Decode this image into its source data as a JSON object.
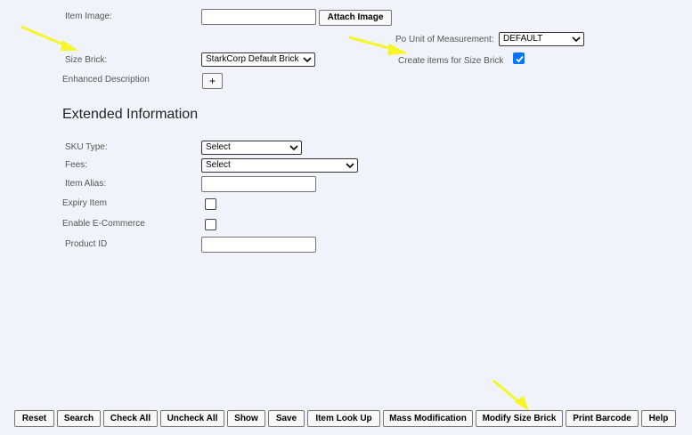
{
  "form": {
    "item_image_label": "Item Image:",
    "attach_image_button": "Attach Image",
    "po_unit_label": "Po Unit of Measurement:",
    "po_unit_value": "DEFAULT",
    "size_brick_label": "Size Brick:",
    "size_brick_value": "StarkCorp Default Brick",
    "create_items_label": "Create items for Size Brick",
    "create_items_checked": true,
    "enhanced_description_label": "Enhanced Description",
    "enhanced_description_button": "+"
  },
  "extended": {
    "heading": "Extended Information",
    "sku_type_label": "SKU Type:",
    "sku_type_value": "Select",
    "fees_label": "Fees:",
    "fees_value": "Select",
    "item_alias_label": "Item Alias:",
    "expiry_item_label": "Expiry Item",
    "enable_ecommerce_label": "Enable E-Commerce",
    "product_id_label": "Product ID"
  },
  "toolbar": {
    "reset": "Reset",
    "search": "Search",
    "check_all": "Check All",
    "uncheck_all": "Uncheck All",
    "show": "Show",
    "save": "Save",
    "item_look_up": "Item Look Up",
    "mass_modification": "Mass Modification",
    "modify_size_brick": "Modify Size Brick",
    "print_barcode": "Print Barcode",
    "help": "Help"
  },
  "colors": {
    "background": "#f0f4fa",
    "checkbox_accent": "#0075ff",
    "annotation_arrow": "#f5f52a"
  },
  "icons": {
    "dropdown": "chevron-down-icon",
    "checkbox_checked": "checkmark-icon",
    "annotation": "yellow-arrow-icon"
  }
}
